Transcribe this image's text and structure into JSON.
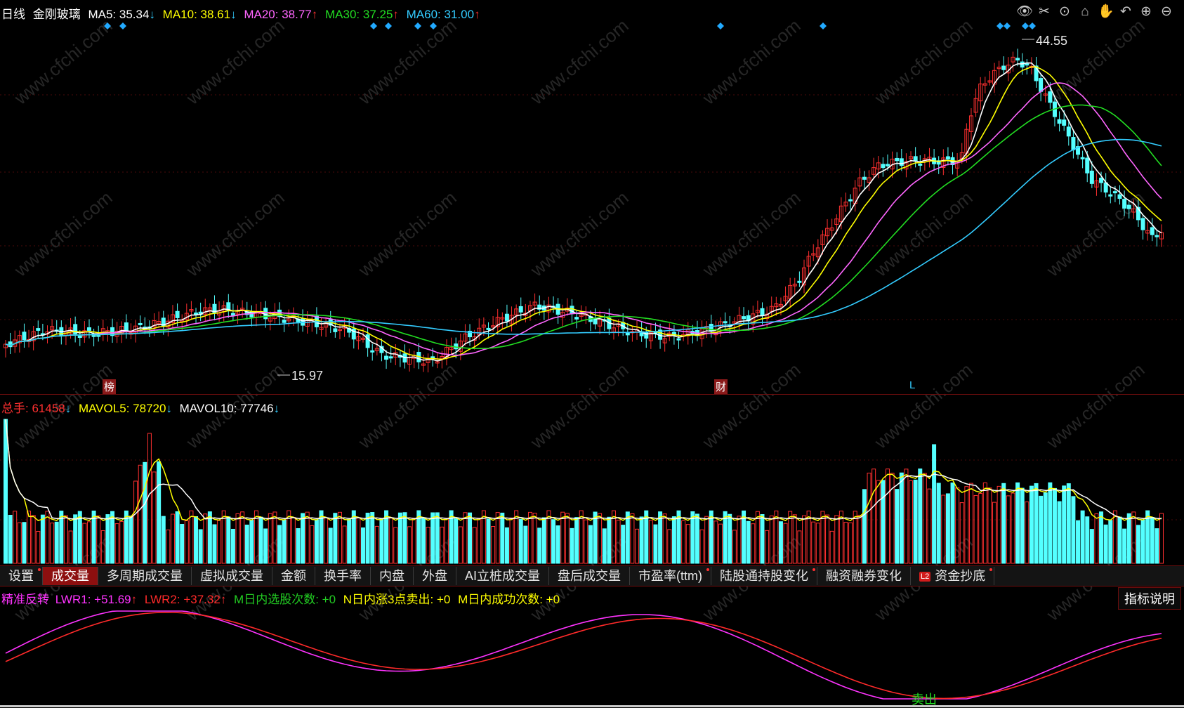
{
  "header": {
    "period": "日线",
    "stock_name": "金刚玻璃",
    "ma": [
      {
        "label": "MA5:",
        "value": "35.34",
        "arrow": "↓",
        "color": "#ffffff"
      },
      {
        "label": "MA10:",
        "value": "38.61",
        "arrow": "↓",
        "color": "#ffff00"
      },
      {
        "label": "MA20:",
        "value": "38.77",
        "arrow": "↑",
        "color": "#ff66ff"
      },
      {
        "label": "MA30:",
        "value": "37.25",
        "arrow": "↑",
        "color": "#22dd22"
      },
      {
        "label": "MA60:",
        "value": "31.00",
        "arrow": "↑",
        "color": "#33ccff"
      }
    ],
    "arrow_colors": {
      "up": "#ff3030",
      "down": "#33ccff"
    }
  },
  "toolbar_icons": [
    "eye-icon",
    "scissors-icon",
    "play-circle-icon",
    "lock-icon",
    "hand-icon",
    "undo-icon",
    "zoom-in-icon",
    "zoom-out-icon"
  ],
  "price_chart": {
    "high_label": "44.55",
    "low_label": "15.97",
    "markers": [
      {
        "text": "榜",
        "color": "#8b1a1a"
      },
      {
        "text": "财",
        "color": "#8b1a1a"
      },
      {
        "text": "L",
        "color": "#33ccff"
      }
    ]
  },
  "volume": {
    "total_label": "总手:",
    "total_value": "61458",
    "total_arrow": "↓",
    "mavol5_label": "MAVOL5:",
    "mavol5_value": "78720",
    "mavol5_arrow": "↓",
    "mavol10_label": "MAVOL10:",
    "mavol10_value": "77746",
    "mavol10_arrow": "↓"
  },
  "tabs": [
    {
      "label": "设置",
      "dot": true,
      "active": false
    },
    {
      "label": "成交量",
      "dot": false,
      "active": true
    },
    {
      "label": "多周期成交量",
      "dot": false,
      "active": false
    },
    {
      "label": "虚拟成交量",
      "dot": false,
      "active": false
    },
    {
      "label": "金额",
      "dot": false,
      "active": false
    },
    {
      "label": "换手率",
      "dot": false,
      "active": false
    },
    {
      "label": "内盘",
      "dot": false,
      "active": false
    },
    {
      "label": "外盘",
      "dot": false,
      "active": false
    },
    {
      "label": "AI立桩成交量",
      "dot": false,
      "active": false
    },
    {
      "label": "盘后成交量",
      "dot": false,
      "active": false
    },
    {
      "label": "市盈率(ttm)",
      "dot": true,
      "active": false
    },
    {
      "label": "陆股通持股变化",
      "dot": true,
      "active": false
    },
    {
      "label": "融资融券变化",
      "dot": false,
      "active": false
    },
    {
      "label": "资金抄底",
      "dot": true,
      "active": false,
      "badge": "L2"
    }
  ],
  "indicator": {
    "name": "精准反转",
    "lwr1_label": "LWR1:",
    "lwr1_value": "+51.69",
    "lwr1_arrow": "↑",
    "lwr2_label": "LWR2:",
    "lwr2_value": "+37.32",
    "lwr2_arrow": "↑",
    "m_select": "M日内选股次数: +0",
    "n_sell": "N日内涨3点卖出: +0",
    "m_success": "M日内成功次数: +0",
    "sell_label": "卖出",
    "explain_button": "指标说明"
  },
  "watermark": "www.cfchi.com",
  "colors": {
    "up": "#ff3030",
    "down": "#54ffff",
    "ma5": "#ffffff",
    "ma10": "#ffff00",
    "ma20": "#ff66ff",
    "ma30": "#22dd22",
    "ma60": "#33ccff",
    "lwr1": "#ff33ff",
    "lwr2": "#ff2a2a"
  }
}
